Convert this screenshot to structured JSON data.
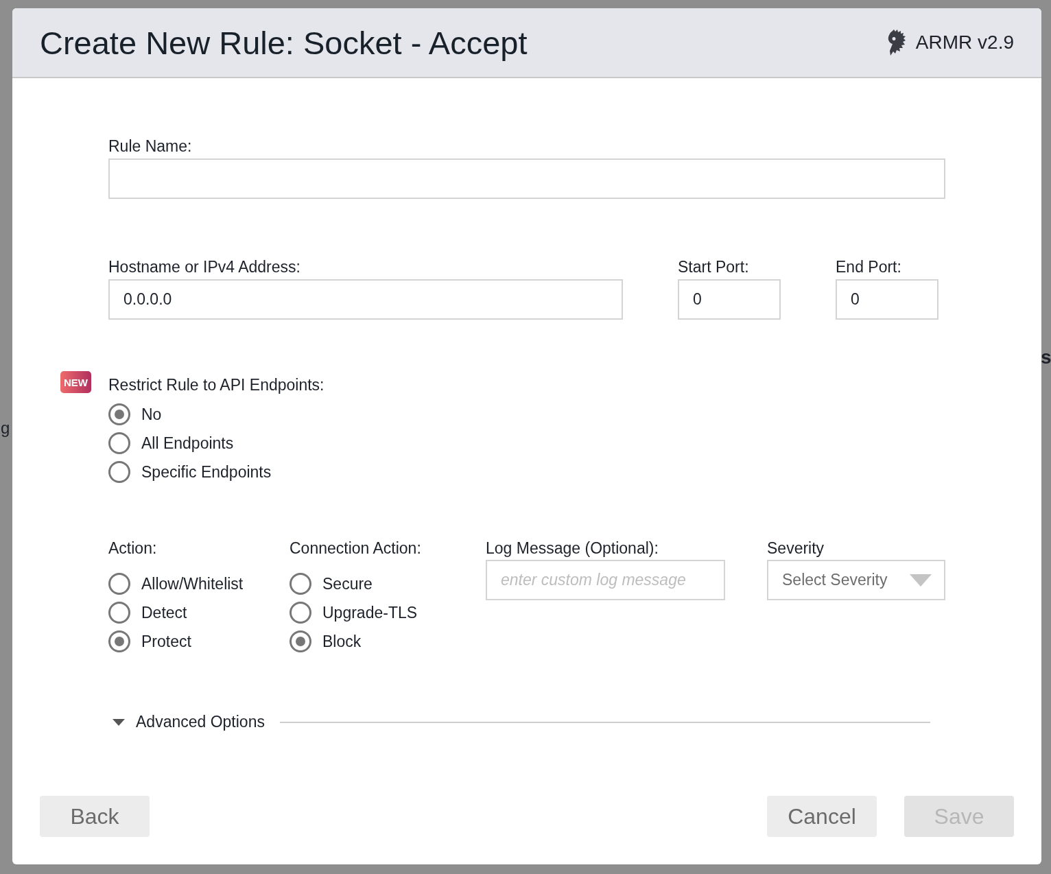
{
  "window": {
    "title": "Create New Rule: Socket - Accept",
    "product": "ARMR v2.9"
  },
  "background": {
    "left_fragment": "g",
    "right_fragment": "s"
  },
  "rule_name": {
    "label": "Rule Name:"
  },
  "host": {
    "label": "Hostname or IPv4 Address:",
    "value": "0.0.0.0"
  },
  "start_port": {
    "label": "Start Port:",
    "value": "0"
  },
  "end_port": {
    "label": "End Port:",
    "value": "0"
  },
  "restrict": {
    "badge": "NEW",
    "label": "Restrict Rule to API Endpoints:",
    "options": [
      {
        "label": "No",
        "selected": true
      },
      {
        "label": "All Endpoints",
        "selected": false
      },
      {
        "label": "Specific Endpoints",
        "selected": false
      }
    ]
  },
  "action": {
    "label": "Action:",
    "options": [
      {
        "label": "Allow/Whitelist",
        "selected": false
      },
      {
        "label": "Detect",
        "selected": false
      },
      {
        "label": "Protect",
        "selected": true
      }
    ]
  },
  "connection_action": {
    "label": "Connection Action:",
    "options": [
      {
        "label": "Secure",
        "selected": false
      },
      {
        "label": "Upgrade-TLS",
        "selected": false
      },
      {
        "label": "Block",
        "selected": true
      }
    ]
  },
  "log_message": {
    "label": "Log Message (Optional):",
    "placeholder": "enter custom log message"
  },
  "severity": {
    "label": "Severity",
    "placeholder": "Select Severity"
  },
  "advanced": {
    "label": "Advanced Options"
  },
  "footer": {
    "back": {
      "label": "Back",
      "disabled": false
    },
    "actions": [
      {
        "label": "Cancel",
        "disabled": false
      },
      {
        "label": "Save",
        "disabled": true
      }
    ]
  }
}
